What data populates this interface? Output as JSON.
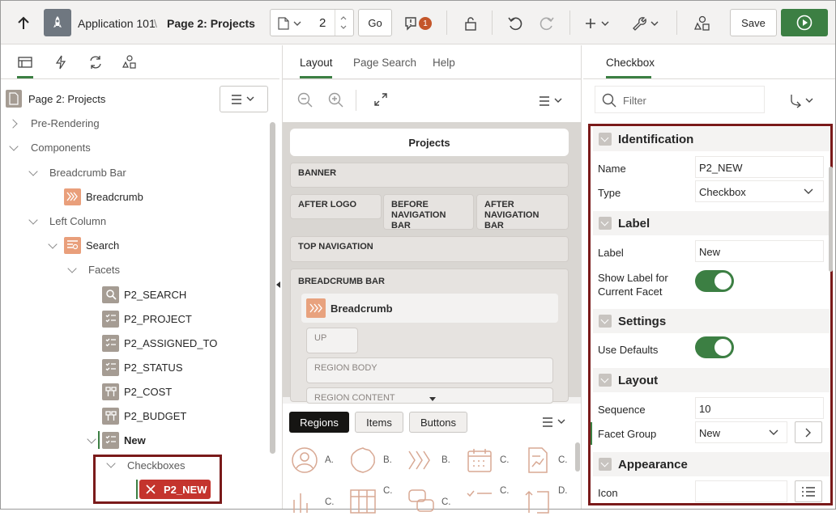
{
  "toolbar": {
    "app_name": "Application 101",
    "crumb_sep": "\\",
    "page_name": "Page 2: Projects",
    "page_number": "2",
    "go_label": "Go",
    "error_count": "1",
    "save_label": "Save"
  },
  "left_panel": {
    "page_title": "Page 2: Projects",
    "tree": {
      "pre_rendering": "Pre-Rendering",
      "components": "Components",
      "breadcrumb_bar": "Breadcrumb Bar",
      "breadcrumb": "Breadcrumb",
      "left_column": "Left Column",
      "search": "Search",
      "facets": "Facets",
      "p2_search": "P2_SEARCH",
      "p2_project": "P2_PROJECT",
      "p2_assigned_to": "P2_ASSIGNED_TO",
      "p2_status": "P2_STATUS",
      "p2_cost": "P2_COST",
      "p2_budget": "P2_BUDGET",
      "new": "New",
      "checkboxes": "Checkboxes",
      "p2_new": "P2_NEW"
    }
  },
  "middle_panel": {
    "tabs": [
      "Layout",
      "Page Search",
      "Help"
    ],
    "page_header": "Projects",
    "regions": {
      "banner": "BANNER",
      "after_logo": "AFTER LOGO",
      "before_nav": "BEFORE NAVIGATION BAR",
      "after_nav": "AFTER NAVIGATION BAR",
      "top_nav": "TOP NAVIGATION",
      "breadcrumb_bar": "BREADCRUMB BAR",
      "breadcrumb_region": "Breadcrumb",
      "up": "UP",
      "region_body": "REGION BODY",
      "region_content": "REGION CONTENT"
    },
    "gallery_tabs": [
      "Regions",
      "Items",
      "Buttons"
    ],
    "gallery_labels": [
      "A.",
      "B.",
      "B.",
      "C.",
      "C.",
      "C.",
      "C.",
      "C.",
      "C.",
      "D."
    ]
  },
  "right_panel": {
    "tab": "Checkbox",
    "filter_placeholder": "Filter",
    "groups": {
      "identification": "Identification",
      "label": "Label",
      "settings": "Settings",
      "layout": "Layout",
      "appearance": "Appearance"
    },
    "fields": {
      "name_label": "Name",
      "name_value": "P2_NEW",
      "type_label": "Type",
      "type_value": "Checkbox",
      "label_label": "Label",
      "label_value": "New",
      "show_label_text": "Show Label for Current Facet",
      "show_label_on": true,
      "use_defaults_label": "Use Defaults",
      "use_defaults_on": true,
      "sequence_label": "Sequence",
      "sequence_value": "10",
      "facet_group_label": "Facet Group",
      "facet_group_value": "New",
      "icon_label": "Icon"
    }
  },
  "colors": {
    "accent_green": "#3c7f43",
    "highlight_red": "#7a1a1a",
    "selected_item": "#c4342d",
    "error_badge": "#c4562a"
  }
}
